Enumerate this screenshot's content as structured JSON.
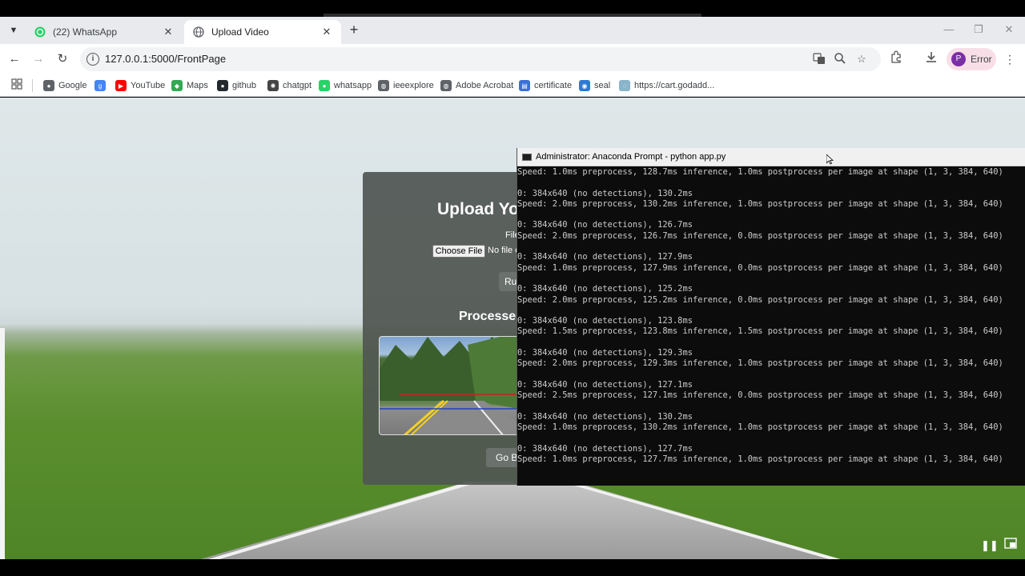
{
  "browser": {
    "tabs": [
      {
        "title": "(22) WhatsApp",
        "active": false,
        "favicon": "whatsapp-icon"
      },
      {
        "title": "Upload Video",
        "active": true,
        "favicon": "globe-icon"
      }
    ],
    "url": "127.0.0.1:5000/FrontPage",
    "profile_initial": "P",
    "profile_label": "Error"
  },
  "bookmarks": [
    {
      "label": "Google",
      "icon": "chrome-icon",
      "color": "#5f6368"
    },
    {
      "label": "",
      "icon": "google-g-icon",
      "color": "#4285f4"
    },
    {
      "label": "YouTube",
      "icon": "youtube-icon",
      "color": "#ff0000"
    },
    {
      "label": "Maps",
      "icon": "maps-icon",
      "color": "#34a853"
    },
    {
      "label": "github",
      "icon": "github-icon",
      "color": "#24292e"
    },
    {
      "label": "chatgpt",
      "icon": "chatgpt-icon",
      "color": "#444444"
    },
    {
      "label": "whatsapp",
      "icon": "whatsapp-icon",
      "color": "#25d366"
    },
    {
      "label": "ieeexplore",
      "icon": "globe-icon",
      "color": "#5f6368"
    },
    {
      "label": "Adobe Acrobat",
      "icon": "globe-icon",
      "color": "#5f6368"
    },
    {
      "label": "certificate",
      "icon": "certificate-icon",
      "color": "#3b6fd8"
    },
    {
      "label": "seal",
      "icon": "seal-icon",
      "color": "#2a7bd8"
    },
    {
      "label": "https://cart.godadd...",
      "icon": "loading-icon",
      "color": "#8ab4c8"
    }
  ],
  "webpage": {
    "upload_title": "Upload Yo",
    "file_label": "File",
    "choose_file": "Choose File",
    "no_file": "No file c",
    "run_button": "Ru",
    "processed_title": "Processe",
    "go_back": "Go B"
  },
  "terminal": {
    "title": "Administrator: Anaconda Prompt - python  app.py",
    "lines": [
      "Speed: 1.0ms preprocess, 128.7ms inference, 1.0ms postprocess per image at shape (1, 3, 384, 640)",
      "",
      "0: 384x640 (no detections), 130.2ms",
      "Speed: 2.0ms preprocess, 130.2ms inference, 1.0ms postprocess per image at shape (1, 3, 384, 640)",
      "",
      "0: 384x640 (no detections), 126.7ms",
      "Speed: 2.0ms preprocess, 126.7ms inference, 0.0ms postprocess per image at shape (1, 3, 384, 640)",
      "",
      "0: 384x640 (no detections), 127.9ms",
      "Speed: 1.0ms preprocess, 127.9ms inference, 0.0ms postprocess per image at shape (1, 3, 384, 640)",
      "",
      "0: 384x640 (no detections), 125.2ms",
      "Speed: 2.0ms preprocess, 125.2ms inference, 0.0ms postprocess per image at shape (1, 3, 384, 640)",
      "",
      "0: 384x640 (no detections), 123.8ms",
      "Speed: 1.5ms preprocess, 123.8ms inference, 1.5ms postprocess per image at shape (1, 3, 384, 640)",
      "",
      "0: 384x640 (no detections), 129.3ms",
      "Speed: 2.0ms preprocess, 129.3ms inference, 1.0ms postprocess per image at shape (1, 3, 384, 640)",
      "",
      "0: 384x640 (no detections), 127.1ms",
      "Speed: 2.5ms preprocess, 127.1ms inference, 0.0ms postprocess per image at shape (1, 3, 384, 640)",
      "",
      "0: 384x640 (no detections), 130.2ms",
      "Speed: 1.0ms preprocess, 130.2ms inference, 1.0ms postprocess per image at shape (1, 3, 384, 640)",
      "",
      "0: 384x640 (no detections), 127.7ms",
      "Speed: 1.0ms preprocess, 127.7ms inference, 1.0ms postprocess per image at shape (1, 3, 384, 640)"
    ]
  },
  "player": {
    "pause_icon": "pause-icon",
    "miniplayer_icon": "miniplayer-icon"
  }
}
